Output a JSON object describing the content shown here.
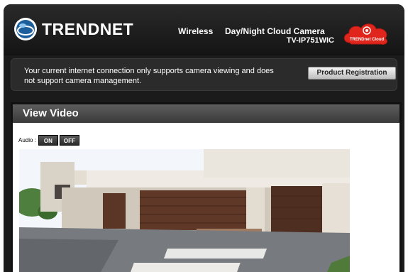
{
  "header": {
    "brand": "TRENDNET",
    "product_type": "Wireless",
    "product_name": "Day/Night Cloud Camera",
    "model": "TV-IP751WIC",
    "cloud_badge_text": "TRENDnet Cloud",
    "brand_color": "#e0261c"
  },
  "notice": {
    "line1": "Your current internet connection only supports camera viewing and does",
    "line2": "not support camera management.",
    "registration_button": "Product Registration"
  },
  "section": {
    "title": "View Video"
  },
  "audio": {
    "label": "Audio :",
    "on_label": "ON",
    "off_label": "OFF"
  }
}
